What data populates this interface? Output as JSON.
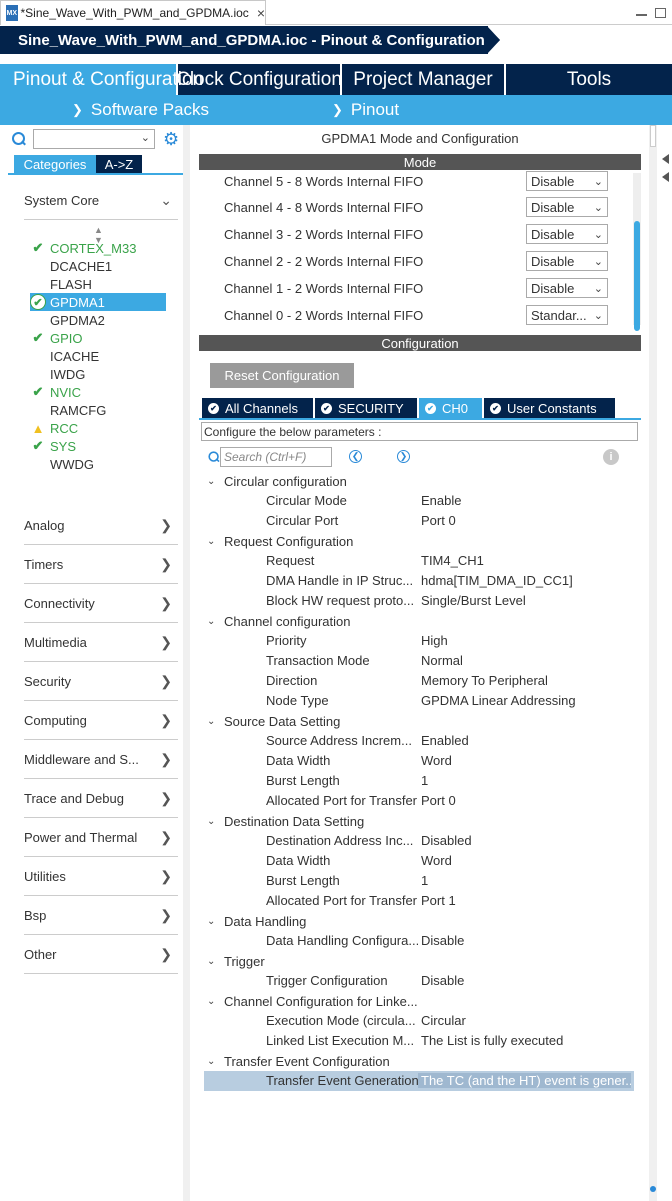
{
  "window": {
    "tab_icon": "MX",
    "tab_title": "*Sine_Wave_With_PWM_and_GPDMA.ioc",
    "tab_close": "×"
  },
  "breadcrumb": {
    "title": "Sine_Wave_With_PWM_and_GPDMA.ioc - Pinout & Configuration"
  },
  "main_tabs": [
    {
      "label": "Pinout & Configuration",
      "active": true
    },
    {
      "label": "Clock Configuration"
    },
    {
      "label": "Project Manager"
    },
    {
      "label": "Tools"
    }
  ],
  "sub_nav": {
    "software_packs": "Software Packs",
    "pinout": "Pinout"
  },
  "left_panel": {
    "category_tab": "Categories",
    "az_tab": "A->Z",
    "system_core": {
      "label": "System Core",
      "items": [
        {
          "label": "CORTEX_M33",
          "status": "check"
        },
        {
          "label": "DCACHE1",
          "status": "none"
        },
        {
          "label": "FLASH",
          "status": "none"
        },
        {
          "label": "GPDMA1",
          "status": "selected"
        },
        {
          "label": "GPDMA2",
          "status": "none"
        },
        {
          "label": "GPIO",
          "status": "check"
        },
        {
          "label": "ICACHE",
          "status": "none"
        },
        {
          "label": "IWDG",
          "status": "none"
        },
        {
          "label": "NVIC",
          "status": "check"
        },
        {
          "label": "RAMCFG",
          "status": "none"
        },
        {
          "label": "RCC",
          "status": "warning"
        },
        {
          "label": "SYS",
          "status": "check"
        },
        {
          "label": "WWDG",
          "status": "none"
        }
      ]
    },
    "groups": [
      "Analog",
      "Timers",
      "Connectivity",
      "Multimedia",
      "Security",
      "Computing",
      "Middleware and S...",
      "Trace and Debug",
      "Power and Thermal",
      "Utilities",
      "Bsp",
      "Other"
    ]
  },
  "right_panel": {
    "title": "GPDMA1 Mode and Configuration",
    "mode_header": "Mode",
    "channels": [
      {
        "label": "Channel 5   - 8 Words Internal FIFO",
        "value": "Disable"
      },
      {
        "label": "Channel 4   - 8 Words Internal FIFO",
        "value": "Disable"
      },
      {
        "label": "Channel 3   - 2 Words Internal FIFO",
        "value": "Disable"
      },
      {
        "label": "Channel 2   - 2 Words Internal FIFO",
        "value": "Disable"
      },
      {
        "label": "Channel 1   - 2 Words Internal FIFO",
        "value": "Disable"
      },
      {
        "label": "Channel 0   - 2 Words Internal FIFO",
        "value": "Standar..."
      }
    ],
    "config_header": "Configuration",
    "reset_button": "Reset Configuration",
    "config_tabs": [
      {
        "label": "All Channels"
      },
      {
        "label": "SECURITY"
      },
      {
        "label": "CH0",
        "active": true
      },
      {
        "label": "User Constants"
      }
    ],
    "configure_hint": "Configure the below parameters :",
    "search_placeholder": "Search (Ctrl+F)",
    "tree": [
      {
        "section": "Circular configuration",
        "params": [
          {
            "k": "Circular Mode",
            "v": "Enable"
          },
          {
            "k": "Circular Port",
            "v": "Port 0"
          }
        ]
      },
      {
        "section": "Request Configuration",
        "params": [
          {
            "k": "Request",
            "v": "TIM4_CH1"
          },
          {
            "k": "DMA Handle in IP Struc...",
            "v": "hdma[TIM_DMA_ID_CC1]"
          },
          {
            "k": "Block HW request proto...",
            "v": "Single/Burst Level"
          }
        ]
      },
      {
        "section": "Channel configuration",
        "params": [
          {
            "k": "Priority",
            "v": "High"
          },
          {
            "k": "Transaction Mode",
            "v": "Normal"
          },
          {
            "k": "Direction",
            "v": "Memory To Peripheral"
          },
          {
            "k": "Node Type",
            "v": "GPDMA Linear Addressing"
          }
        ]
      },
      {
        "section": "Source Data Setting",
        "params": [
          {
            "k": "Source Address Increm...",
            "v": "Enabled"
          },
          {
            "k": "Data Width",
            "v": "Word"
          },
          {
            "k": "Burst Length",
            "v": "1"
          },
          {
            "k": "Allocated Port for Transfer",
            "v": "Port 0"
          }
        ]
      },
      {
        "section": "Destination Data Setting",
        "params": [
          {
            "k": "Destination Address Inc...",
            "v": "Disabled"
          },
          {
            "k": "Data Width",
            "v": "Word"
          },
          {
            "k": "Burst Length",
            "v": "1"
          },
          {
            "k": "Allocated Port for Transfer",
            "v": "Port 1"
          }
        ]
      },
      {
        "section": "Data Handling",
        "params": [
          {
            "k": "Data Handling Configura...",
            "v": "Disable"
          }
        ]
      },
      {
        "section": "Trigger",
        "params": [
          {
            "k": "Trigger Configuration",
            "v": "Disable"
          }
        ]
      },
      {
        "section": "Channel Configuration for Linke...",
        "params": [
          {
            "k": "Execution Mode (circula...",
            "v": "Circular"
          },
          {
            "k": "Linked List Execution M...",
            "v": "The List is fully executed"
          }
        ]
      },
      {
        "section": "Transfer Event Configuration",
        "params": [
          {
            "k": "Transfer Event Generation",
            "v": "The TC (and the HT) event is gener...",
            "highlight": true
          }
        ]
      }
    ]
  },
  "colors": {
    "navy": "#03234b",
    "accent_blue": "#3ca9e2",
    "ok_green": "#3aa34a",
    "warning_yellow": "#f0c020",
    "header_gray": "#555555"
  }
}
